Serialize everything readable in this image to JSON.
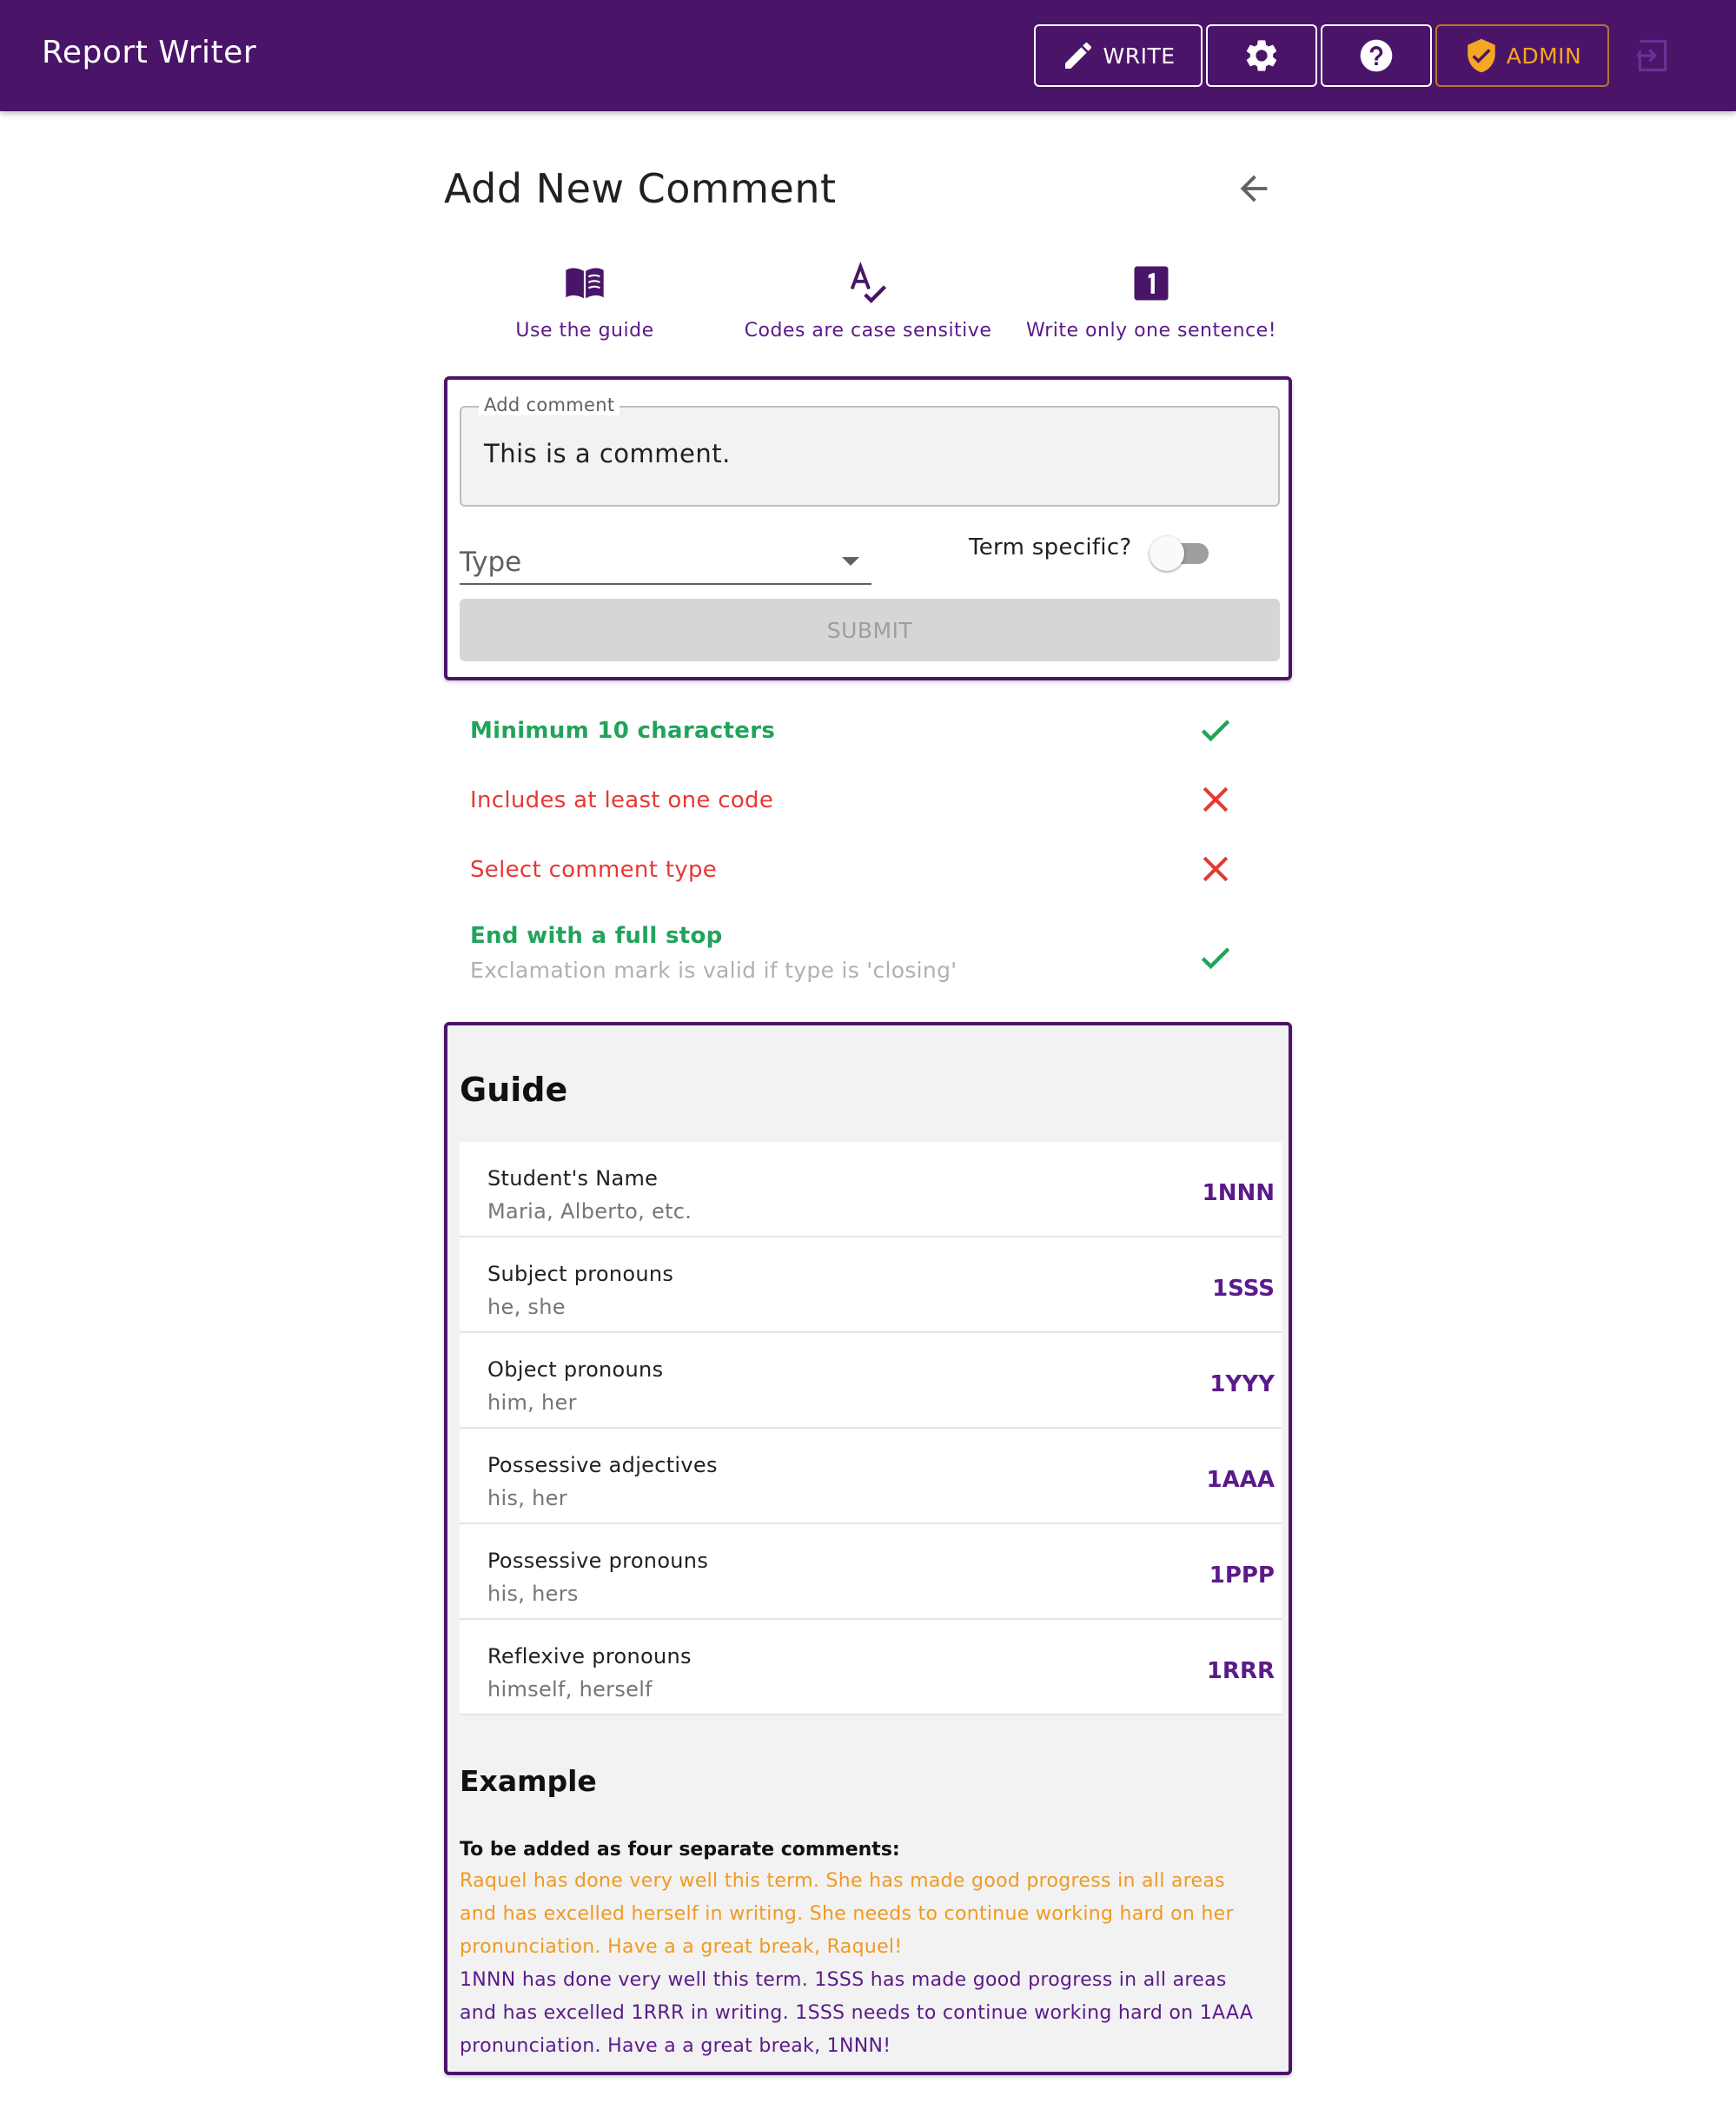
{
  "header": {
    "title": "Report Writer",
    "write_label": "WRITE",
    "admin_label": "ADMIN"
  },
  "page": {
    "title": "Add New Comment"
  },
  "tips": [
    {
      "icon": "book-icon",
      "label": "Use the guide"
    },
    {
      "icon": "spellcheck-icon",
      "label": "Codes are case sensitive"
    },
    {
      "icon": "number-one-icon",
      "label": "Write only one sentence!"
    }
  ],
  "form": {
    "comment_legend": "Add comment",
    "comment_value": "This is a comment.",
    "type_placeholder": "Type",
    "term_label": "Term specific?",
    "term_specific": false,
    "submit_label": "SUBMIT"
  },
  "validation": [
    {
      "text": "Minimum 10 characters",
      "status": "pass"
    },
    {
      "text": "Includes at least one code",
      "status": "fail"
    },
    {
      "text": "Select comment type",
      "status": "fail"
    },
    {
      "text": "End with a full stop",
      "sub": "Exclamation mark is valid if type is 'closing'",
      "status": "pass"
    }
  ],
  "guide": {
    "heading": "Guide",
    "rows": [
      {
        "name": "Student's Name",
        "examples": "Maria, Alberto, etc.",
        "code": "1NNN"
      },
      {
        "name": "Subject pronouns",
        "examples": "he, she",
        "code": "1SSS"
      },
      {
        "name": "Object pronouns",
        "examples": "him, her",
        "code": "1YYY"
      },
      {
        "name": "Possessive adjectives",
        "examples": "his, her",
        "code": "1AAA"
      },
      {
        "name": "Possessive pronouns",
        "examples": "his, hers",
        "code": "1PPP"
      },
      {
        "name": "Reflexive pronouns",
        "examples": "himself, herself",
        "code": "1RRR"
      }
    ],
    "example_heading": "Example",
    "example_intro": "To be added as four separate comments:",
    "example_original": "Raquel has done very well this term. She has made good progress in all areas and has excelled herself in writing. She needs to continue working hard on her pronunciation. Have a a great break, Raquel!",
    "example_coded": "1NNN has done very well this term. 1SSS has made good progress in all areas and has excelled 1RRR in writing. 1SSS needs to continue working hard on 1AAA pronunciation. Have a a great break, 1NNN!"
  },
  "colors": {
    "primary": "#4a1568",
    "accent_orange": "#f5a623",
    "pass": "#22a35a",
    "fail": "#e53935",
    "code_purple": "#5b1a8a"
  }
}
